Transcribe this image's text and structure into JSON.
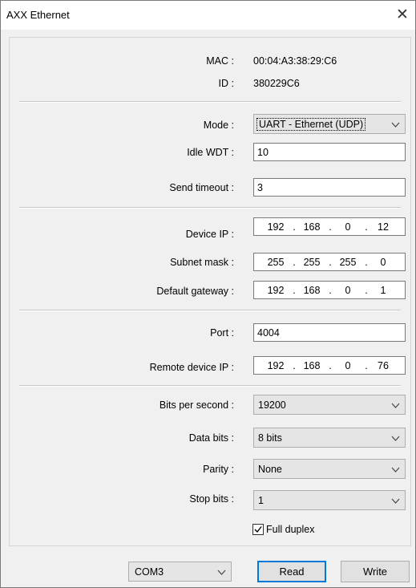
{
  "window": {
    "title": "AXX Ethernet",
    "close_glyph": "✕"
  },
  "info": {
    "mac_label": "MAC :",
    "mac_value": "00:04:A3:38:29:C6",
    "id_label": "ID :",
    "id_value": "380229C6"
  },
  "general": {
    "mode_label": "Mode :",
    "mode_value": "UART - Ethernet (UDP)",
    "idle_wdt_label": "Idle WDT :",
    "idle_wdt_value": "10",
    "send_timeout_label": "Send timeout :",
    "send_timeout_value": "3"
  },
  "network": {
    "device_ip_label": "Device IP :",
    "device_ip": [
      "192",
      "168",
      "0",
      "12"
    ],
    "subnet_label": "Subnet mask :",
    "subnet": [
      "255",
      "255",
      "255",
      "0"
    ],
    "gateway_label": "Default gateway :",
    "gateway": [
      "192",
      "168",
      "0",
      "1"
    ]
  },
  "remote": {
    "port_label": "Port :",
    "port_value": "4004",
    "remote_ip_label": "Remote device IP :",
    "remote_ip": [
      "192",
      "168",
      "0",
      "76"
    ]
  },
  "serial": {
    "bps_label": "Bits per second :",
    "bps_value": "19200",
    "data_bits_label": "Data bits :",
    "data_bits_value": "8 bits",
    "parity_label": "Parity :",
    "parity_value": "None",
    "stop_bits_label": "Stop bits :",
    "stop_bits_value": "1",
    "full_duplex_label": "Full duplex",
    "full_duplex_checked": true
  },
  "footer": {
    "com_port": "COM3",
    "read_label": "Read",
    "write_label": "Write"
  },
  "ip_dot": "."
}
